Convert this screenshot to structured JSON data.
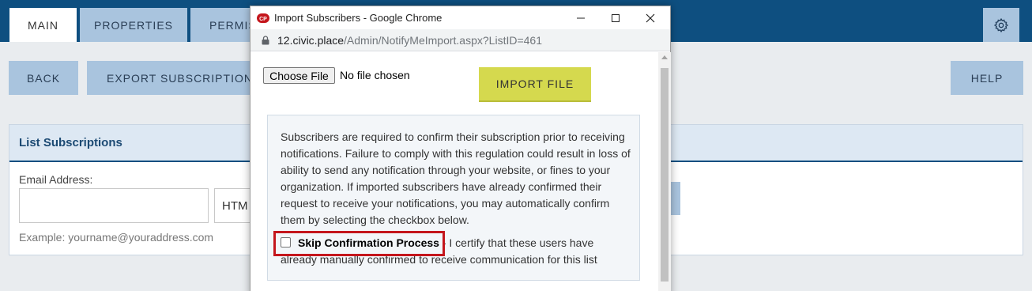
{
  "tabs": [
    {
      "label": "MAIN",
      "active": true
    },
    {
      "label": "PROPERTIES",
      "active": false
    },
    {
      "label": "PERMIS",
      "active": false
    }
  ],
  "header": {
    "settings_icon": "gear-icon"
  },
  "toolbar": {
    "back": "BACK",
    "export": "EXPORT SUBSCRIPTIONS",
    "help": "HELP"
  },
  "panel": {
    "title": "List Subscriptions",
    "email_label": "Email Address:",
    "email_value": "",
    "format_value": "HTM",
    "example": "Example: yourname@youraddress.com"
  },
  "popup": {
    "window_title": "Import Subscribers - Google Chrome",
    "url_host": "12.civic.place",
    "url_path": "/Admin/NotifyMeImport.aspx?ListID=461",
    "choose_file": "Choose File",
    "no_file": "No file chosen",
    "import_button": "IMPORT FILE",
    "info_text": "Subscribers are required to confirm their subscription prior to receiving notifications. Failure to comply with this regulation could result in loss of ability to send any notification through your website, or fines to your organization. If imported subscribers have already confirmed their request to receive your notifications, you may automatically confirm them by selecting the checkbox below.",
    "skip_label": "Skip Confirmation Process",
    "skip_text": " - I certify that these users have already manually confirmed to receive communication for this list",
    "skip_checked": false
  },
  "colors": {
    "header_bg": "#0e4f80",
    "tab_bg": "#a9c4de",
    "import_btn": "#d5d94e",
    "highlight_border": "#c4161c"
  }
}
